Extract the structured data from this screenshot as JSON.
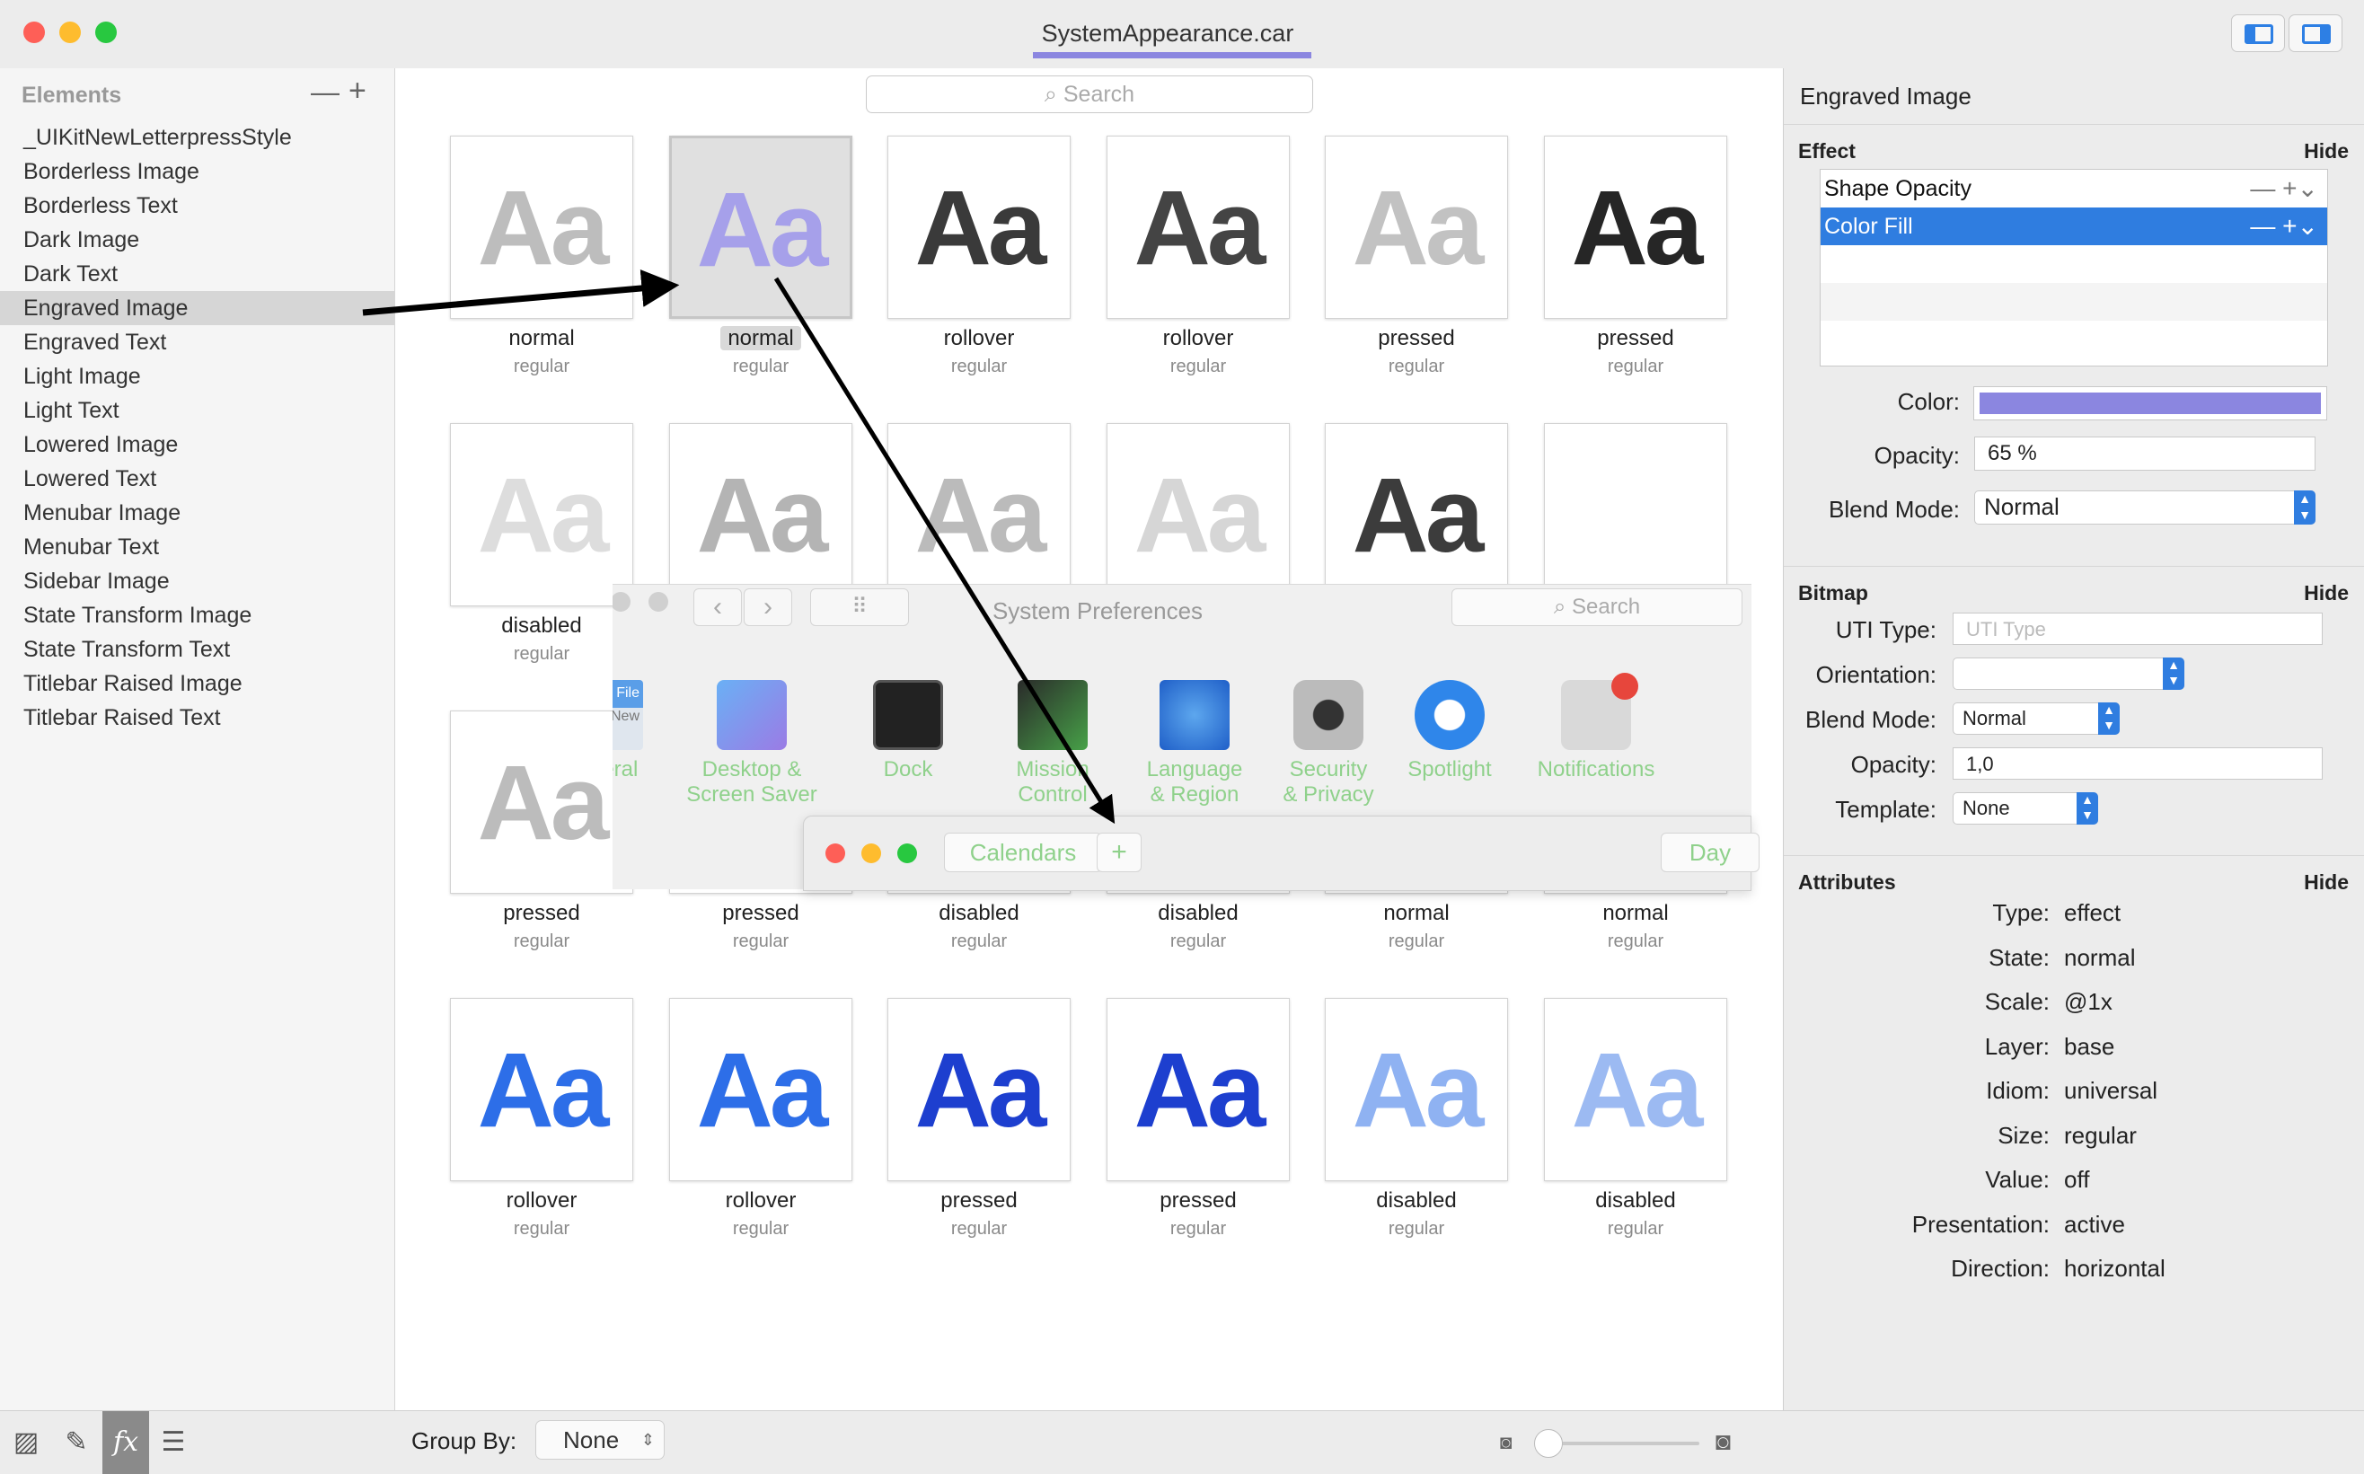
{
  "window": {
    "title": "SystemAppearance.car"
  },
  "colors": {
    "close": "#fe5f57",
    "minimize": "#febc2e",
    "zoom": "#28c840",
    "accent": "#2f7de0",
    "fill_color": "#8b86e0"
  },
  "sidebar": {
    "header": "Elements",
    "minus": "—",
    "plus": "+",
    "items": [
      {
        "label": "_UIKitNewLetterpressStyle"
      },
      {
        "label": "Borderless Image"
      },
      {
        "label": "Borderless Text"
      },
      {
        "label": "Dark Image"
      },
      {
        "label": "Dark Text"
      },
      {
        "label": "Engraved Image",
        "selected": true
      },
      {
        "label": "Engraved Text"
      },
      {
        "label": "Light Image"
      },
      {
        "label": "Light Text"
      },
      {
        "label": "Lowered Image"
      },
      {
        "label": "Lowered Text"
      },
      {
        "label": "Menubar Image"
      },
      {
        "label": "Menubar Text"
      },
      {
        "label": "Sidebar Image"
      },
      {
        "label": "State Transform Image"
      },
      {
        "label": "State Transform Text"
      },
      {
        "label": "Titlebar Raised Image"
      },
      {
        "label": "Titlebar Raised Text"
      }
    ]
  },
  "search": {
    "placeholder": "Search"
  },
  "grid": {
    "glyph": "Aa",
    "cells": [
      {
        "state": "normal",
        "size": "regular",
        "color": "#bdbdbd"
      },
      {
        "state": "normal",
        "size": "regular",
        "color": "#a6a0ea",
        "selected": true
      },
      {
        "state": "rollover",
        "size": "regular",
        "color": "#3a3a3a"
      },
      {
        "state": "rollover",
        "size": "regular",
        "color": "#444444"
      },
      {
        "state": "pressed",
        "size": "regular",
        "color": "#c2c2c2"
      },
      {
        "state": "pressed",
        "size": "regular",
        "color": "#262626"
      },
      {
        "state": "disabled",
        "size": "regular",
        "color": "#dddddd"
      },
      {
        "state": "",
        "size": "",
        "color": "#b4b4b4"
      },
      {
        "state": "",
        "size": "",
        "color": "#bbbbbb"
      },
      {
        "state": "",
        "size": "",
        "color": "#d6d6d6"
      },
      {
        "state": "",
        "size": "",
        "color": "#3c3c3c"
      },
      {
        "state": "",
        "size": "",
        "color": "#ffffff"
      },
      {
        "state": "pressed",
        "size": "regular",
        "color": "#bcbcbc"
      },
      {
        "state": "pressed",
        "size": "regular",
        "color": "#bcbcbc"
      },
      {
        "state": "disabled",
        "size": "regular",
        "color": "#cccccc"
      },
      {
        "state": "disabled",
        "size": "regular",
        "color": "#cccccc"
      },
      {
        "state": "normal",
        "size": "regular",
        "color": "#cccccc"
      },
      {
        "state": "normal",
        "size": "regular",
        "color": "#cccccc"
      },
      {
        "state": "rollover",
        "size": "regular",
        "color": "#2d6ee8"
      },
      {
        "state": "rollover",
        "size": "regular",
        "color": "#2d6ee8"
      },
      {
        "state": "pressed",
        "size": "regular",
        "color": "#1d3fcf"
      },
      {
        "state": "pressed",
        "size": "regular",
        "color": "#1d3fcf"
      },
      {
        "state": "disabled",
        "size": "regular",
        "color": "#8fb2f2"
      },
      {
        "state": "disabled",
        "size": "regular",
        "color": "#9cbaf2"
      }
    ]
  },
  "sysprefs": {
    "title": "System Preferences",
    "search_placeholder": "Search",
    "nav_back": "‹",
    "nav_forward": "›",
    "grid_icon": "⠿",
    "items": [
      {
        "label": "eneral",
        "icon": "general-icon"
      },
      {
        "label": "Desktop &\nScreen Saver",
        "icon": "desktop-icon"
      },
      {
        "label": "Dock",
        "icon": "dock-icon"
      },
      {
        "label": "Mission\nControl",
        "icon": "mission-control-icon"
      },
      {
        "label": "Language\n& Region",
        "icon": "globe-icon"
      },
      {
        "label": "Security\n& Privacy",
        "icon": "house-lock-icon"
      },
      {
        "label": "Spotlight",
        "icon": "spotlight-icon"
      },
      {
        "label": "Notifications",
        "icon": "notifications-icon"
      }
    ],
    "general_file": "File",
    "general_new": "New"
  },
  "calendar": {
    "calendars": "Calendars",
    "add": "+",
    "day": "Day"
  },
  "inspector": {
    "title": "Engraved Image",
    "effect": {
      "header": "Effect",
      "hide": "Hide",
      "rows": [
        {
          "label": "Shape Opacity"
        },
        {
          "label": "Color Fill",
          "selected": true
        }
      ],
      "row_controls": "—  +⌄",
      "color_label": "Color:",
      "opacity_label": "Opacity:",
      "opacity": "65 %",
      "blend_label": "Blend Mode:",
      "blend": "Normal"
    },
    "bitmap": {
      "header": "Bitmap",
      "hide": "Hide",
      "uti_label": "UTI Type:",
      "uti_placeholder": "UTI Type",
      "orientation_label": "Orientation:",
      "orientation": "",
      "blend_label": "Blend Mode:",
      "blend": "Normal",
      "opacity_label": "Opacity:",
      "opacity": "1,0",
      "template_label": "Template:",
      "template": "None"
    },
    "attributes": {
      "header": "Attributes",
      "hide": "Hide",
      "rows": [
        {
          "label": "Type:",
          "value": "effect"
        },
        {
          "label": "State:",
          "value": "normal"
        },
        {
          "label": "Scale:",
          "value": "@1x"
        },
        {
          "label": "Layer:",
          "value": "base"
        },
        {
          "label": "Idiom:",
          "value": "universal"
        },
        {
          "label": "Size:",
          "value": "regular"
        },
        {
          "label": "Value:",
          "value": "off"
        },
        {
          "label": "Presentation:",
          "value": "active"
        },
        {
          "label": "Direction:",
          "value": "horizontal"
        }
      ]
    }
  },
  "bottom": {
    "groupby_label": "Group By:",
    "groupby_value": "None",
    "fx": "fx"
  }
}
